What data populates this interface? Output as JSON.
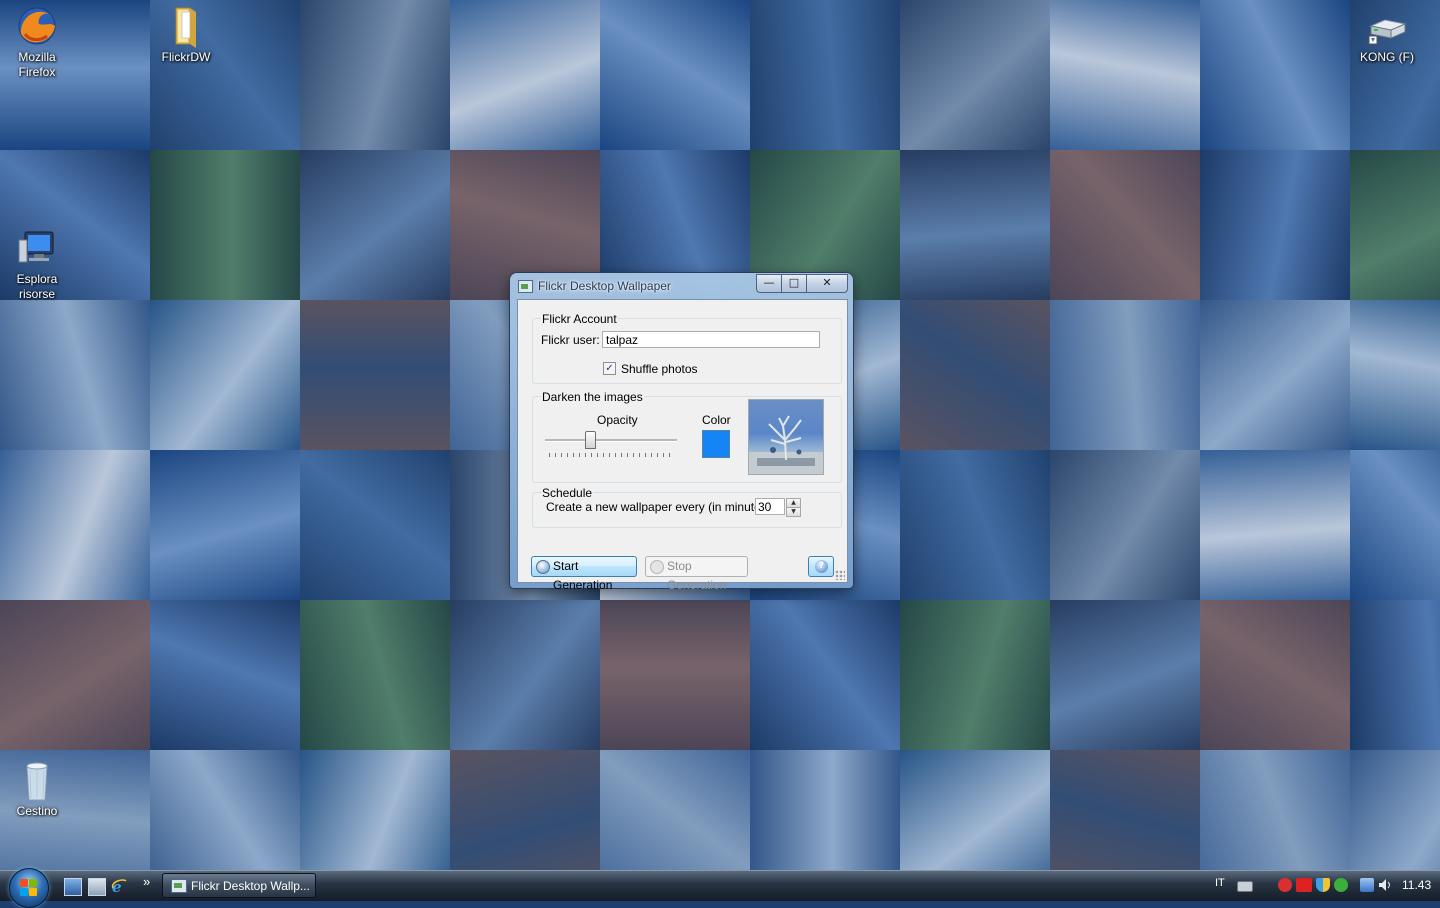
{
  "desktop": {
    "icons": {
      "firefox": "Mozilla Firefox",
      "flickrdw": "FlickrDW",
      "explorer": "Esplora risorse",
      "drive": "KONG (F)",
      "recycle": "Cestino"
    }
  },
  "dialog": {
    "title": "Flickr Desktop Wallpaper",
    "caption_buttons": {
      "minimize": "—",
      "maximize": "□",
      "close": "✕"
    },
    "account": {
      "group_label": "Flickr Account",
      "user_label": "Flickr user:",
      "user_value": "talpaz",
      "shuffle_label": "Shuffle photos",
      "shuffle_checked": true
    },
    "darken": {
      "group_label": "Darken the images",
      "opacity_label": "Opacity",
      "opacity_level": 0.33,
      "color_label": "Color",
      "color": "#1584f4"
    },
    "schedule": {
      "group_label": "Schedule",
      "interval_label": "Create a new wallpaper every (in minutes):",
      "interval_value": "30"
    },
    "buttons": {
      "start": "Start Generation",
      "stop": "Stop Generation",
      "help": "?"
    }
  },
  "taskbar": {
    "task_label": "Flickr Desktop Wallp...",
    "language": "IT",
    "clock": "11.43",
    "overflow": "»"
  },
  "colors": {
    "overlay_tint": "#1c3f6e",
    "accent": "#1584f4"
  }
}
